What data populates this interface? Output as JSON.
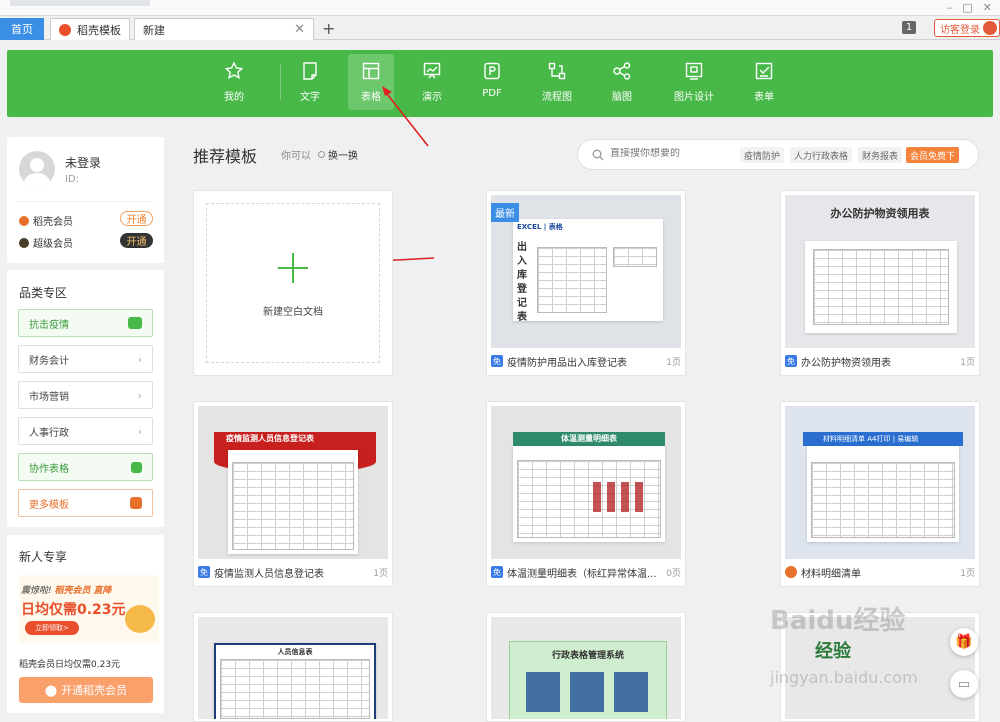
{
  "tabs": {
    "home": "首页",
    "daoke": "稻壳模板",
    "new": "新建",
    "badge": "1",
    "visitor": "访客登录"
  },
  "nav": [
    {
      "label": "我的",
      "icon": "star-icon"
    },
    {
      "label": "文字",
      "icon": "document-icon"
    },
    {
      "label": "表格",
      "icon": "table-icon"
    },
    {
      "label": "演示",
      "icon": "presentation-icon"
    },
    {
      "label": "PDF",
      "icon": "pdf-icon"
    },
    {
      "label": "流程图",
      "icon": "flowchart-icon"
    },
    {
      "label": "脑图",
      "icon": "mindmap-icon"
    },
    {
      "label": "图片设计",
      "icon": "image-design-icon"
    },
    {
      "label": "表单",
      "icon": "form-icon"
    }
  ],
  "nav_active_index": 2,
  "user": {
    "name": "未登录",
    "id_label": "ID:",
    "vip1": "稻壳会员",
    "vip1_btn": "开通",
    "vip2": "超级会员",
    "vip2_btn": "开通"
  },
  "categories": {
    "title": "品类专区",
    "items": [
      "抗击疫情",
      "财务会计",
      "市场营销",
      "人事行政",
      "协作表格",
      "更多模板"
    ]
  },
  "newuser": {
    "title": "新人专享",
    "promo_line1": "震惊啦!",
    "promo_brand": "稻壳会员",
    "promo_tag": "直降",
    "promo_price": "日均仅需0.23元",
    "promo_btn": "立即领取>",
    "desc": "稻壳会员日均仅需0.23元",
    "button": "开通稻壳会员"
  },
  "main": {
    "title": "推荐模板",
    "maybe": "你可以",
    "swap": "换一换",
    "search_placeholder": "直接搜你想要的",
    "tags": [
      "疫情防护",
      "人力行政表格",
      "财务报表",
      "会员免费下"
    ]
  },
  "cards": {
    "blank_label": "新建空白文档",
    "new_badge": "最新",
    "items": [
      {
        "name": "疫情防护用品出入库登记表",
        "pages": "1页",
        "type": "免"
      },
      {
        "name": "办公防护物资领用表",
        "pages": "1页",
        "type": "免"
      },
      {
        "name": "疫情监测人员信息登记表",
        "pages": "1页",
        "type": "免"
      },
      {
        "name": "体温测量明细表（标红异常体温...",
        "pages": "0页",
        "type": "免"
      },
      {
        "name": "材料明细清单",
        "pages": "1页",
        "type": "vip"
      }
    ],
    "thumb_texts": {
      "t1_brand": "EXCEL | 表格",
      "t1_side": "出入库登记表",
      "t2_title": "办公防护物资领用表",
      "t3_title": "疫情监测人员信息登记表",
      "t4_title": "体温测量明细表",
      "t5_title": "材料明细清单",
      "t5_sub": "A4打印 | 易编辑",
      "t7_title": "人员信息表",
      "t8_title": "行政表格管理系统",
      "t9_title": "经验"
    }
  },
  "watermark": {
    "text": "Baidu经验",
    "url": "jingyan.baidu.com"
  }
}
